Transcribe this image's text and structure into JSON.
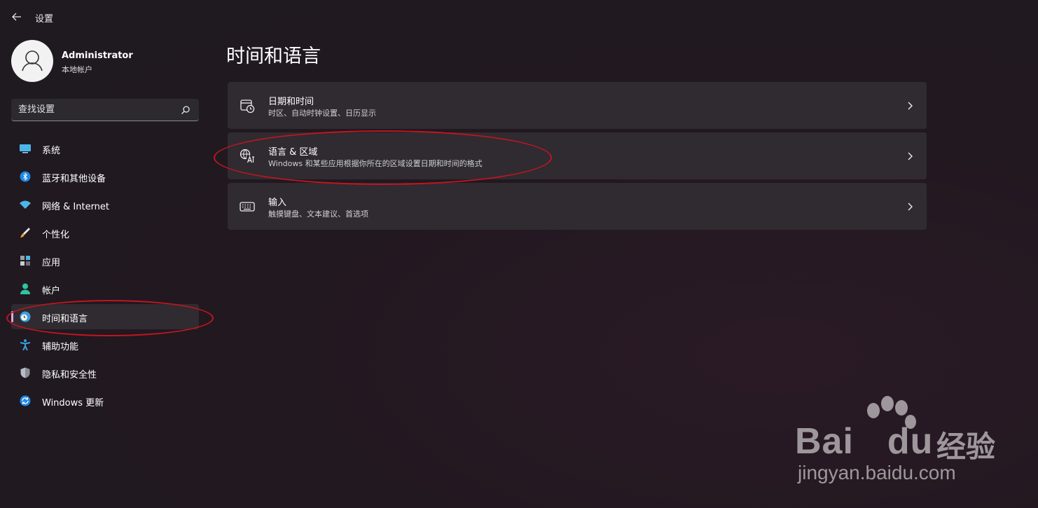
{
  "window": {
    "title": "设置"
  },
  "profile": {
    "name": "Administrator",
    "account_type": "本地帐户"
  },
  "search": {
    "placeholder": "查找设置"
  },
  "sidebar": {
    "items": [
      {
        "label": "系统",
        "icon": "display-icon"
      },
      {
        "label": "蓝牙和其他设备",
        "icon": "bluetooth-icon"
      },
      {
        "label": "网络 & Internet",
        "icon": "wifi-icon"
      },
      {
        "label": "个性化",
        "icon": "brush-icon"
      },
      {
        "label": "应用",
        "icon": "apps-icon"
      },
      {
        "label": "帐户",
        "icon": "person-icon"
      },
      {
        "label": "时间和语言",
        "icon": "globe-clock-icon",
        "selected": true
      },
      {
        "label": "辅助功能",
        "icon": "accessibility-icon"
      },
      {
        "label": "隐私和安全性",
        "icon": "shield-icon"
      },
      {
        "label": "Windows 更新",
        "icon": "update-icon"
      }
    ]
  },
  "main": {
    "title": "时间和语言",
    "cards": [
      {
        "title": "日期和时间",
        "subtitle": "时区、自动时钟设置、日历显示",
        "icon": "calendar-clock-icon"
      },
      {
        "title": "语言 & 区域",
        "subtitle": "Windows 和某些应用根据你所在的区域设置日期和时间的格式",
        "icon": "language-icon"
      },
      {
        "title": "输入",
        "subtitle": "触摸键盘、文本建议、首选项",
        "icon": "keyboard-icon"
      }
    ]
  },
  "watermark": {
    "brand": "Bai",
    "brand_du": "du",
    "brand_cn": "经验",
    "url": "jingyan.baidu.com"
  },
  "colors": {
    "accent": "#d9a8e6",
    "annotation": "#c0161f",
    "card": "#2f2b31"
  }
}
